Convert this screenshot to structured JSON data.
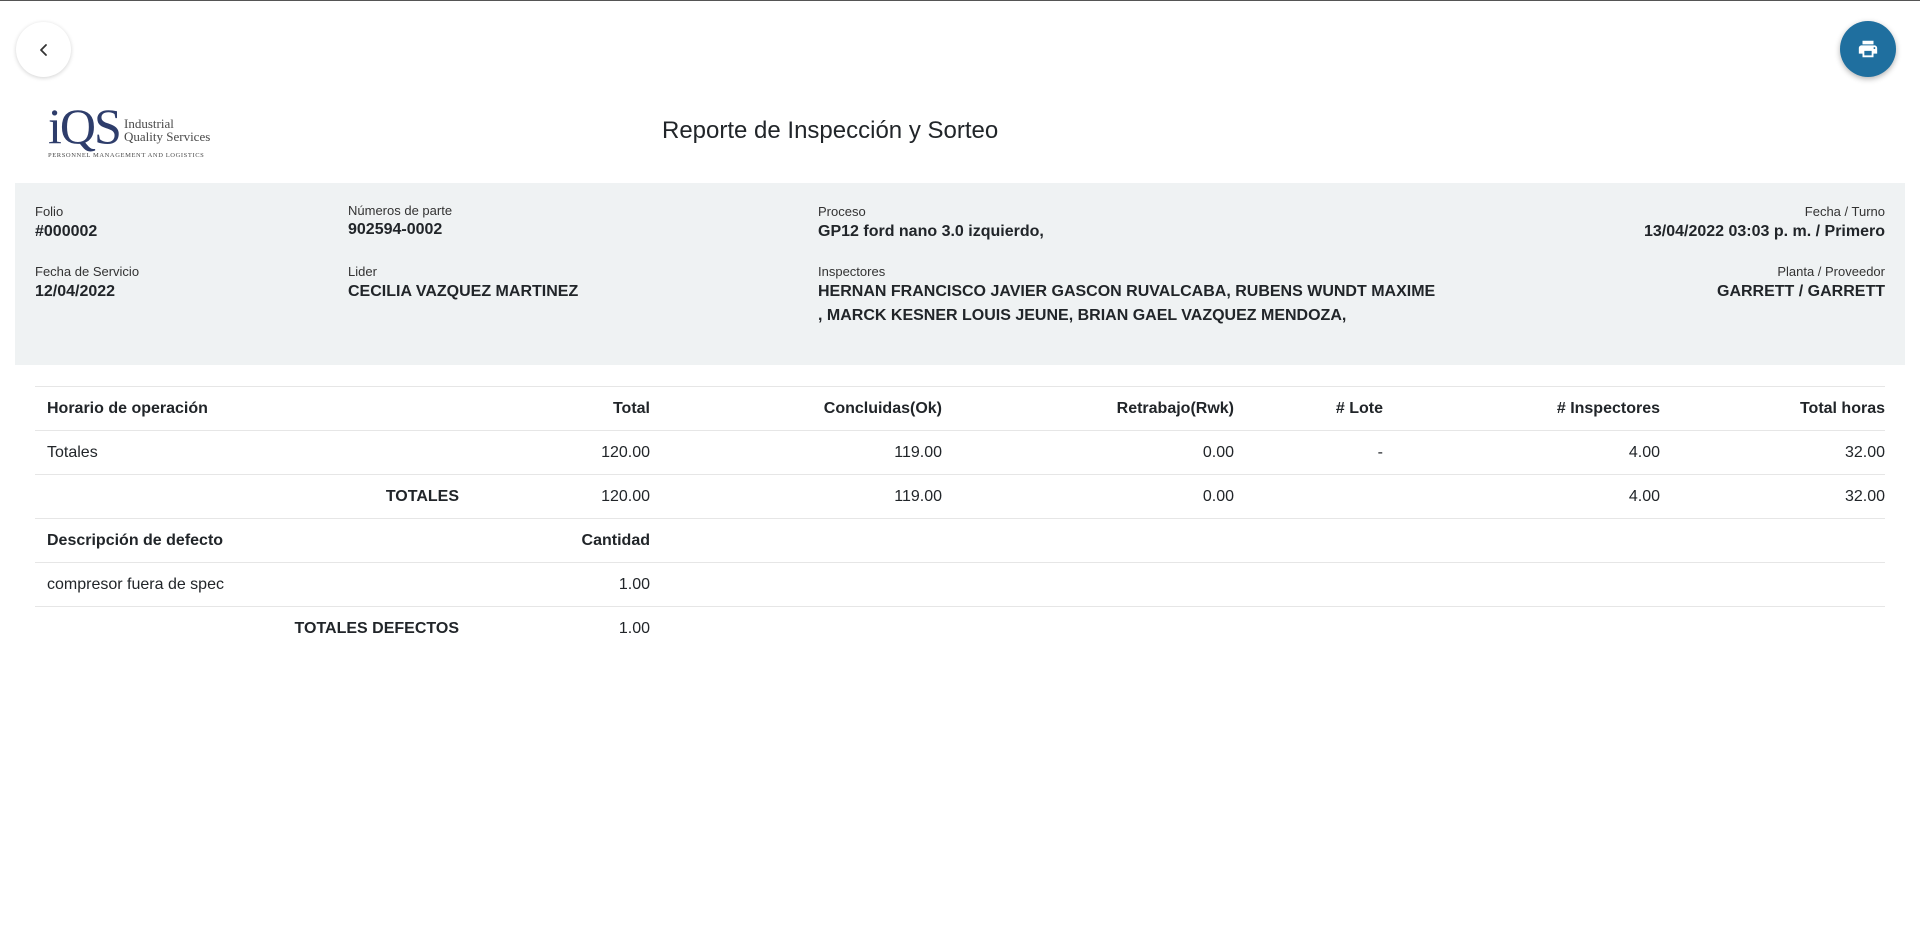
{
  "nav": {
    "back_icon": "chevron-left-icon",
    "print_icon": "printer-icon"
  },
  "logo": {
    "mark": "iQS",
    "name_line1": "Industrial",
    "name_line2": "Quality Services",
    "tagline": "PERSONNEL MANAGEMENT AND LOGISTICS"
  },
  "title": "Reporte de Inspección y Sorteo",
  "info": {
    "folio": {
      "label": "Folio",
      "value": "#000002"
    },
    "part_numbers": {
      "label": "Números de parte",
      "value": "902594-0002"
    },
    "process": {
      "label": "Proceso",
      "value": "GP12 ford nano 3.0 izquierdo,"
    },
    "date_shift": {
      "label": "Fecha / Turno",
      "value": "13/04/2022 03:03 p. m. / Primero"
    },
    "service_date": {
      "label": "Fecha de Servicio",
      "value": "12/04/2022"
    },
    "leader": {
      "label": "Lider",
      "value": "CECILIA VAZQUEZ MARTINEZ"
    },
    "inspectors": {
      "label": "Inspectores",
      "value_line1": "HERNAN FRANCISCO JAVIER GASCON RUVALCABA, RUBENS WUNDT MAXIME",
      "value_line2": ", MARCK KESNER LOUIS JEUNE, BRIAN GAEL VAZQUEZ MENDOZA,"
    },
    "plant_supplier": {
      "label": "Planta / Proveedor",
      "value": "GARRETT / GARRETT"
    }
  },
  "operations": {
    "headers": [
      "Horario de operación",
      "Total",
      "Concluidas(Ok)",
      "Retrabajo(Rwk)",
      "# Lote",
      "# Inspectores",
      "Total horas"
    ],
    "rows": [
      [
        "Totales",
        "120.00",
        "119.00",
        "0.00",
        "-",
        "4.00",
        "32.00"
      ]
    ],
    "totals": {
      "label": "TOTALES",
      "total": "120.00",
      "ok": "119.00",
      "rwk": "0.00",
      "lote": "",
      "inspectors": "4.00",
      "hours": "32.00"
    }
  },
  "defects": {
    "headers": [
      "Descripción de defecto",
      "Cantidad"
    ],
    "rows": [
      [
        "compresor fuera de spec",
        "1.00"
      ]
    ],
    "totals": {
      "label": "TOTALES DEFECTOS",
      "quantity": "1.00"
    }
  }
}
